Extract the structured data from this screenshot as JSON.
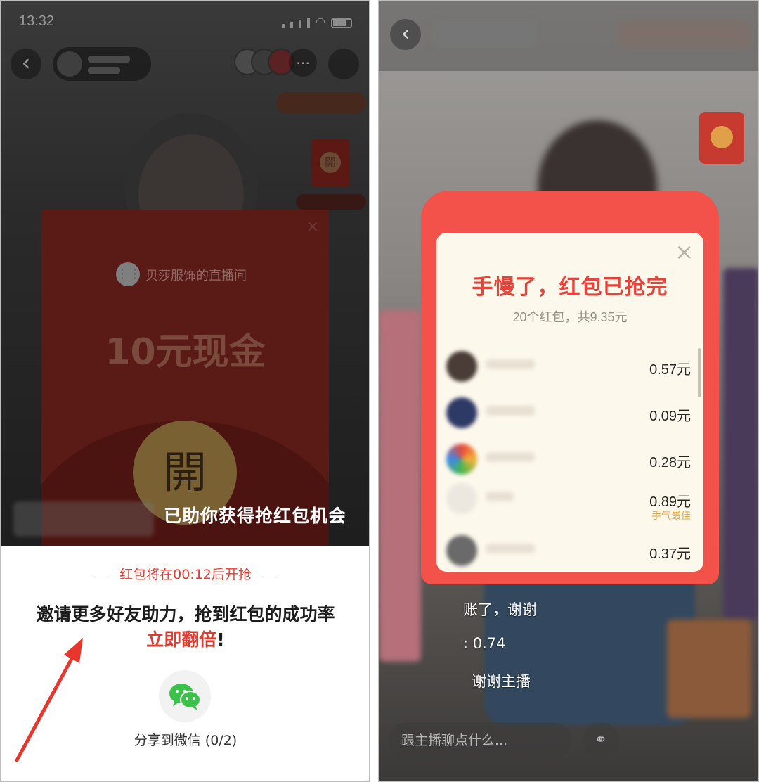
{
  "left": {
    "status": {
      "time": "13:32"
    },
    "envelope": {
      "store_name": "贝莎服饰的直播间",
      "amount": "10元现金",
      "open_label": "開"
    },
    "toast": "已助你获得抢红包机会",
    "sheet": {
      "countdown": "红包将在00:12后开抢",
      "invite_line1": "邀请更多好友助力，抢到红包的成功率",
      "invite_highlight": "立即翻倍",
      "invite_suffix": "!",
      "share_label": "分享到微信 (0/2)"
    },
    "colors": {
      "accent": "#e23b2f",
      "wechat": "#3cc14a"
    }
  },
  "right": {
    "popup": {
      "title": "手慢了，红包已抢完",
      "subtitle": "20个红包，共9.35元",
      "records": [
        {
          "amount": "0.57元",
          "best_luck": ""
        },
        {
          "amount": "0.09元",
          "best_luck": ""
        },
        {
          "amount": "0.28元",
          "best_luck": ""
        },
        {
          "amount": "0.89元",
          "best_luck": "手气最佳"
        },
        {
          "amount": "0.37元",
          "best_luck": ""
        }
      ]
    },
    "chat": {
      "line1": "账了，谢谢",
      "line2": ": 0.74",
      "line3": "谢谢主播"
    },
    "input_placeholder": "跟主播聊点什么...",
    "colors": {
      "popup": "#f2524a",
      "title": "#e8433a"
    }
  }
}
